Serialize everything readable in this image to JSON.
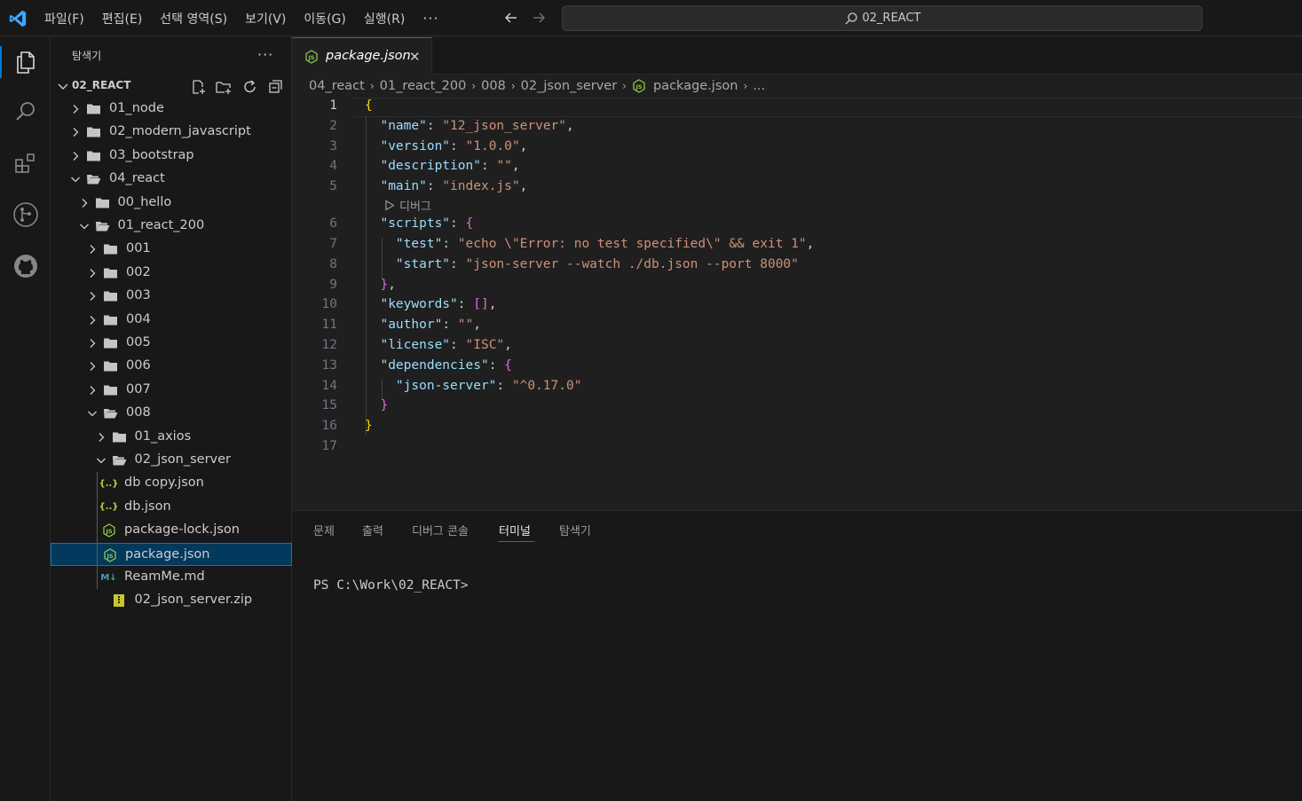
{
  "titlebar": {
    "menu": [
      "파일(F)",
      "편집(E)",
      "선택 영역(S)",
      "보기(V)",
      "이동(G)",
      "실행(R)"
    ],
    "more": "···",
    "search_text": "02_REACT"
  },
  "activitybar": {
    "items": [
      "explorer-icon",
      "search-icon",
      "extensions-icon",
      "source-control-icon",
      "github-icon"
    ]
  },
  "sidebar": {
    "title": "탐색기",
    "more": "···",
    "section": "02_REACT",
    "tree": [
      {
        "label": "01_node",
        "type": "folder",
        "depth": 0,
        "expanded": false
      },
      {
        "label": "02_modern_javascript",
        "type": "folder",
        "depth": 0,
        "expanded": false
      },
      {
        "label": "03_bootstrap",
        "type": "folder",
        "depth": 0,
        "expanded": false
      },
      {
        "label": "04_react",
        "type": "folder",
        "depth": 0,
        "expanded": true
      },
      {
        "label": "00_hello",
        "type": "folder",
        "depth": 1,
        "expanded": false
      },
      {
        "label": "01_react_200",
        "type": "folder",
        "depth": 1,
        "expanded": true
      },
      {
        "label": "001",
        "type": "folder",
        "depth": 2,
        "expanded": false
      },
      {
        "label": "002",
        "type": "folder",
        "depth": 2,
        "expanded": false
      },
      {
        "label": "003",
        "type": "folder",
        "depth": 2,
        "expanded": false
      },
      {
        "label": "004",
        "type": "folder",
        "depth": 2,
        "expanded": false
      },
      {
        "label": "005",
        "type": "folder",
        "depth": 2,
        "expanded": false
      },
      {
        "label": "006",
        "type": "folder",
        "depth": 2,
        "expanded": false
      },
      {
        "label": "007",
        "type": "folder",
        "depth": 2,
        "expanded": false
      },
      {
        "label": "008",
        "type": "folder",
        "depth": 2,
        "expanded": true
      },
      {
        "label": "01_axios",
        "type": "folder",
        "depth": 3,
        "expanded": false
      },
      {
        "label": "02_json_server",
        "type": "folder",
        "depth": 3,
        "expanded": true
      },
      {
        "label": "db copy.json",
        "type": "json",
        "depth": 4
      },
      {
        "label": "db.json",
        "type": "json",
        "depth": 4
      },
      {
        "label": "package-lock.json",
        "type": "node",
        "depth": 4
      },
      {
        "label": "package.json",
        "type": "node",
        "depth": 4,
        "selected": true
      },
      {
        "label": "ReamMe.md",
        "type": "md",
        "depth": 4
      },
      {
        "label": "02_json_server.zip",
        "type": "zip",
        "depth": 3
      }
    ],
    "icon_text": {
      "json": "{..}",
      "md": "M↓"
    }
  },
  "editor": {
    "tab_label": "package.json",
    "tab_close": "✕",
    "breadcrumbs": [
      "04_react",
      "01_react_200",
      "008",
      "02_json_server",
      "package.json",
      "..."
    ],
    "line_numbers": [
      "1",
      "2",
      "3",
      "4",
      "5",
      "6",
      "7",
      "8",
      "9",
      "10",
      "11",
      "12",
      "13",
      "14",
      "15",
      "16",
      "17"
    ],
    "codelens": "디버그",
    "code": {
      "name_key": "\"name\"",
      "name_val": "\"12_json_server\"",
      "version_key": "\"version\"",
      "version_val": "\"1.0.0\"",
      "description_key": "\"description\"",
      "description_val": "\"\"",
      "main_key": "\"main\"",
      "main_val": "\"index.js\"",
      "scripts_key": "\"scripts\"",
      "test_key": "\"test\"",
      "test_val": "\"echo \\\"Error: no test specified\\\" && exit 1\"",
      "start_key": "\"start\"",
      "start_val": "\"json-server --watch ./db.json --port 8000\"",
      "keywords_key": "\"keywords\"",
      "author_key": "\"author\"",
      "author_val": "\"\"",
      "license_key": "\"license\"",
      "license_val": "\"ISC\"",
      "dependencies_key": "\"dependencies\"",
      "jsonserver_key": "\"json-server\"",
      "jsonserver_val": "\"^0.17.0\""
    }
  },
  "panel": {
    "tabs": [
      "문제",
      "출력",
      "디버그 콘솔",
      "터미널",
      "탐색기"
    ],
    "active_tab": "터미널",
    "terminal_prompt": "PS C:\\Work\\02_REACT>"
  },
  "colors": {
    "accent": "#0078d4",
    "json_key": "#9cdcfe",
    "json_string": "#ce9178",
    "bracket_gold": "#ffd700",
    "bracket_purple": "#da70d6",
    "node_green": "#8cc84b"
  }
}
